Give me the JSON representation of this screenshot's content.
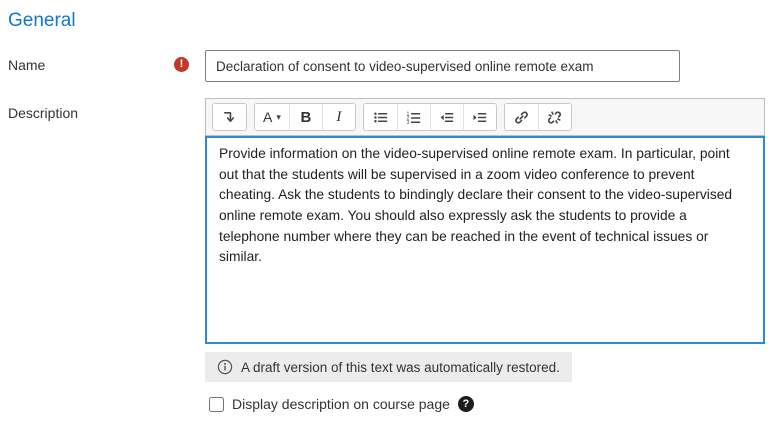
{
  "colors": {
    "heading_blue": "#1177d1",
    "focus_border_blue": "#2a8bd4",
    "required_red": "#c0392b",
    "notice_background": "#ececec"
  },
  "general": {
    "section_title": "General"
  },
  "name_field": {
    "label": "Name",
    "required_mark": "!",
    "value": "Declaration of consent to video-supervised online remote exam"
  },
  "description_field": {
    "label": "Description",
    "toolbar": {
      "collapse_icon": "arrow-down-icon",
      "font_label": "A",
      "font_caret": "▾",
      "bold_label": "B",
      "italic_label": "I",
      "icon_buttons": [
        "unordered-list",
        "ordered-list",
        "outdent",
        "indent",
        "link",
        "unlink"
      ]
    },
    "text": "Provide information on the video-supervised online remote exam. In particular, point out that the students will be supervised in a zoom video conference to prevent cheating. Ask the students to bindingly declare their consent to the video-supervised online remote exam. You should also expressly ask the students to provide a telephone number where they can be reached in the event of technical issues or similar.",
    "draft_notice": "A draft version of this text was automatically restored."
  },
  "display_description": {
    "label": "Display description on course page",
    "checked": false,
    "help_mark": "?"
  }
}
